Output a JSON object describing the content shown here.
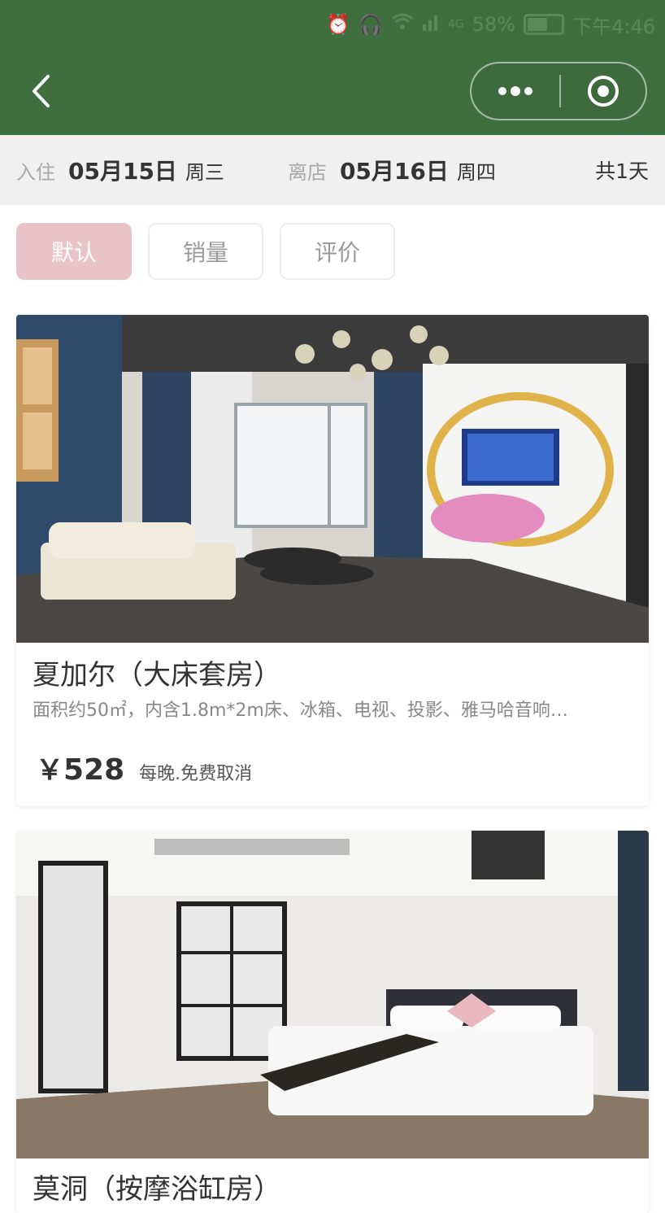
{
  "status_bar": {
    "battery": "58%",
    "time": "下午4:46",
    "network": "4G",
    "icons": [
      "alarm-icon",
      "headset-icon",
      "wifi-icon",
      "signal-icon",
      "signal-4g-icon",
      "battery-icon"
    ]
  },
  "nav": {
    "back_icon": "chevron-left-icon",
    "more_icon": "more-dots-icon",
    "close_icon": "target-circle-icon"
  },
  "stay": {
    "checkin_label": "入住",
    "checkin_date": "05月15日",
    "checkin_weekday": "周三",
    "checkout_label": "离店",
    "checkout_date": "05月16日",
    "checkout_weekday": "周四",
    "total": "共1天"
  },
  "sort": {
    "options": [
      {
        "label": "默认",
        "active": true
      },
      {
        "label": "销量",
        "active": false
      },
      {
        "label": "评价",
        "active": false
      }
    ]
  },
  "rooms": [
    {
      "name": "夏加尔（大床套房）",
      "desc": "面积约50㎡，内含1.8m*2m床、冰箱、电视、投影、雅马哈音响…",
      "currency": "￥",
      "price": "528",
      "price_note": "每晚.免费取消"
    },
    {
      "name": "莫洞（按摩浴缸房）"
    }
  ],
  "colors": {
    "header_bg": "#3f6f3f",
    "active_sort_bg": "#e8c4c8",
    "date_bar_bg": "#f0f0f0"
  }
}
